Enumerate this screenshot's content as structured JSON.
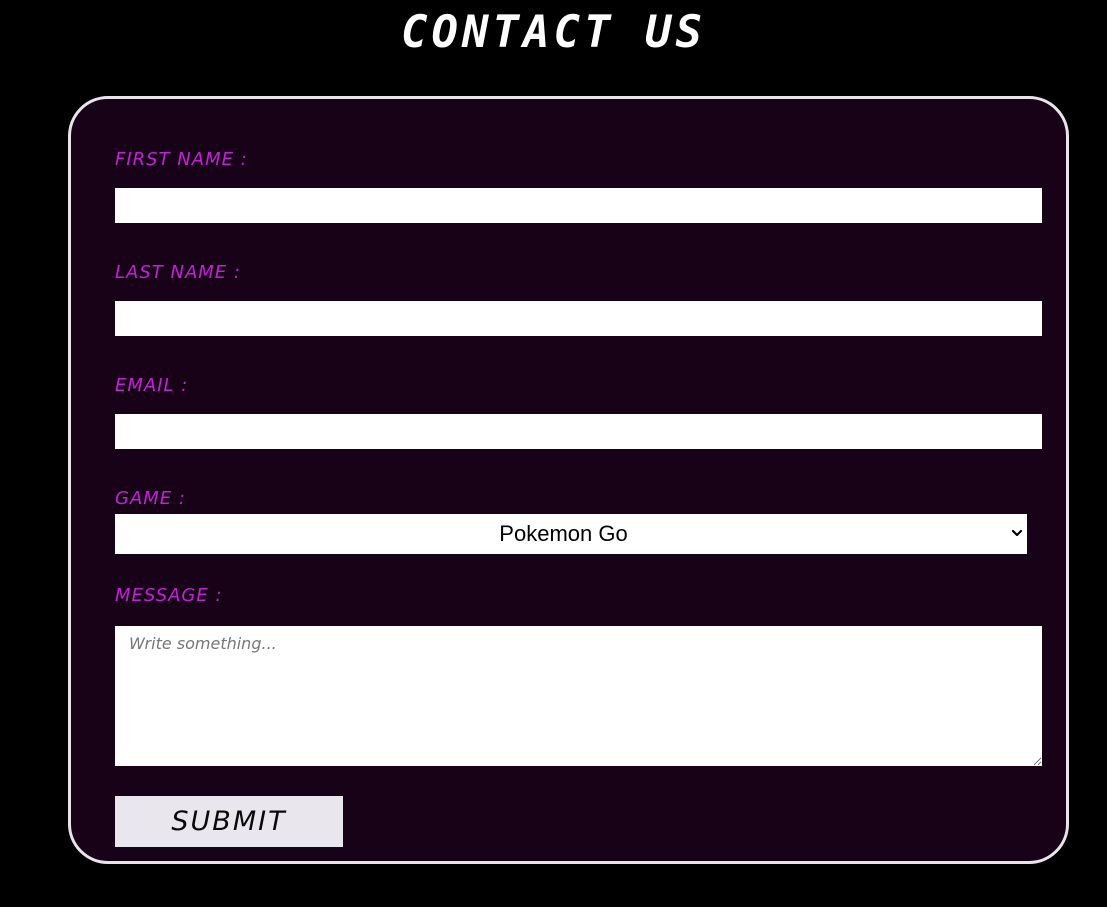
{
  "page": {
    "title": "CONTACT US"
  },
  "form": {
    "first_name": {
      "label": "FIRST NAME :",
      "value": ""
    },
    "last_name": {
      "label": "LAST NAME :",
      "value": ""
    },
    "email": {
      "label": "EMAIL :",
      "value": ""
    },
    "game": {
      "label": "GAME :",
      "selected": "Pokemon Go"
    },
    "message": {
      "label": "MESSAGE :",
      "placeholder": "Write something..."
    },
    "submit_label": "SUBMIT"
  },
  "colors": {
    "page_background": "#000000",
    "card_background": "#170218",
    "card_border": "#e8e4ea",
    "label_color": "#c41fd9",
    "title_color": "#ffffff",
    "button_background": "#e9e7ed"
  },
  "icons": {
    "select_arrow": "chevron-down-icon"
  }
}
